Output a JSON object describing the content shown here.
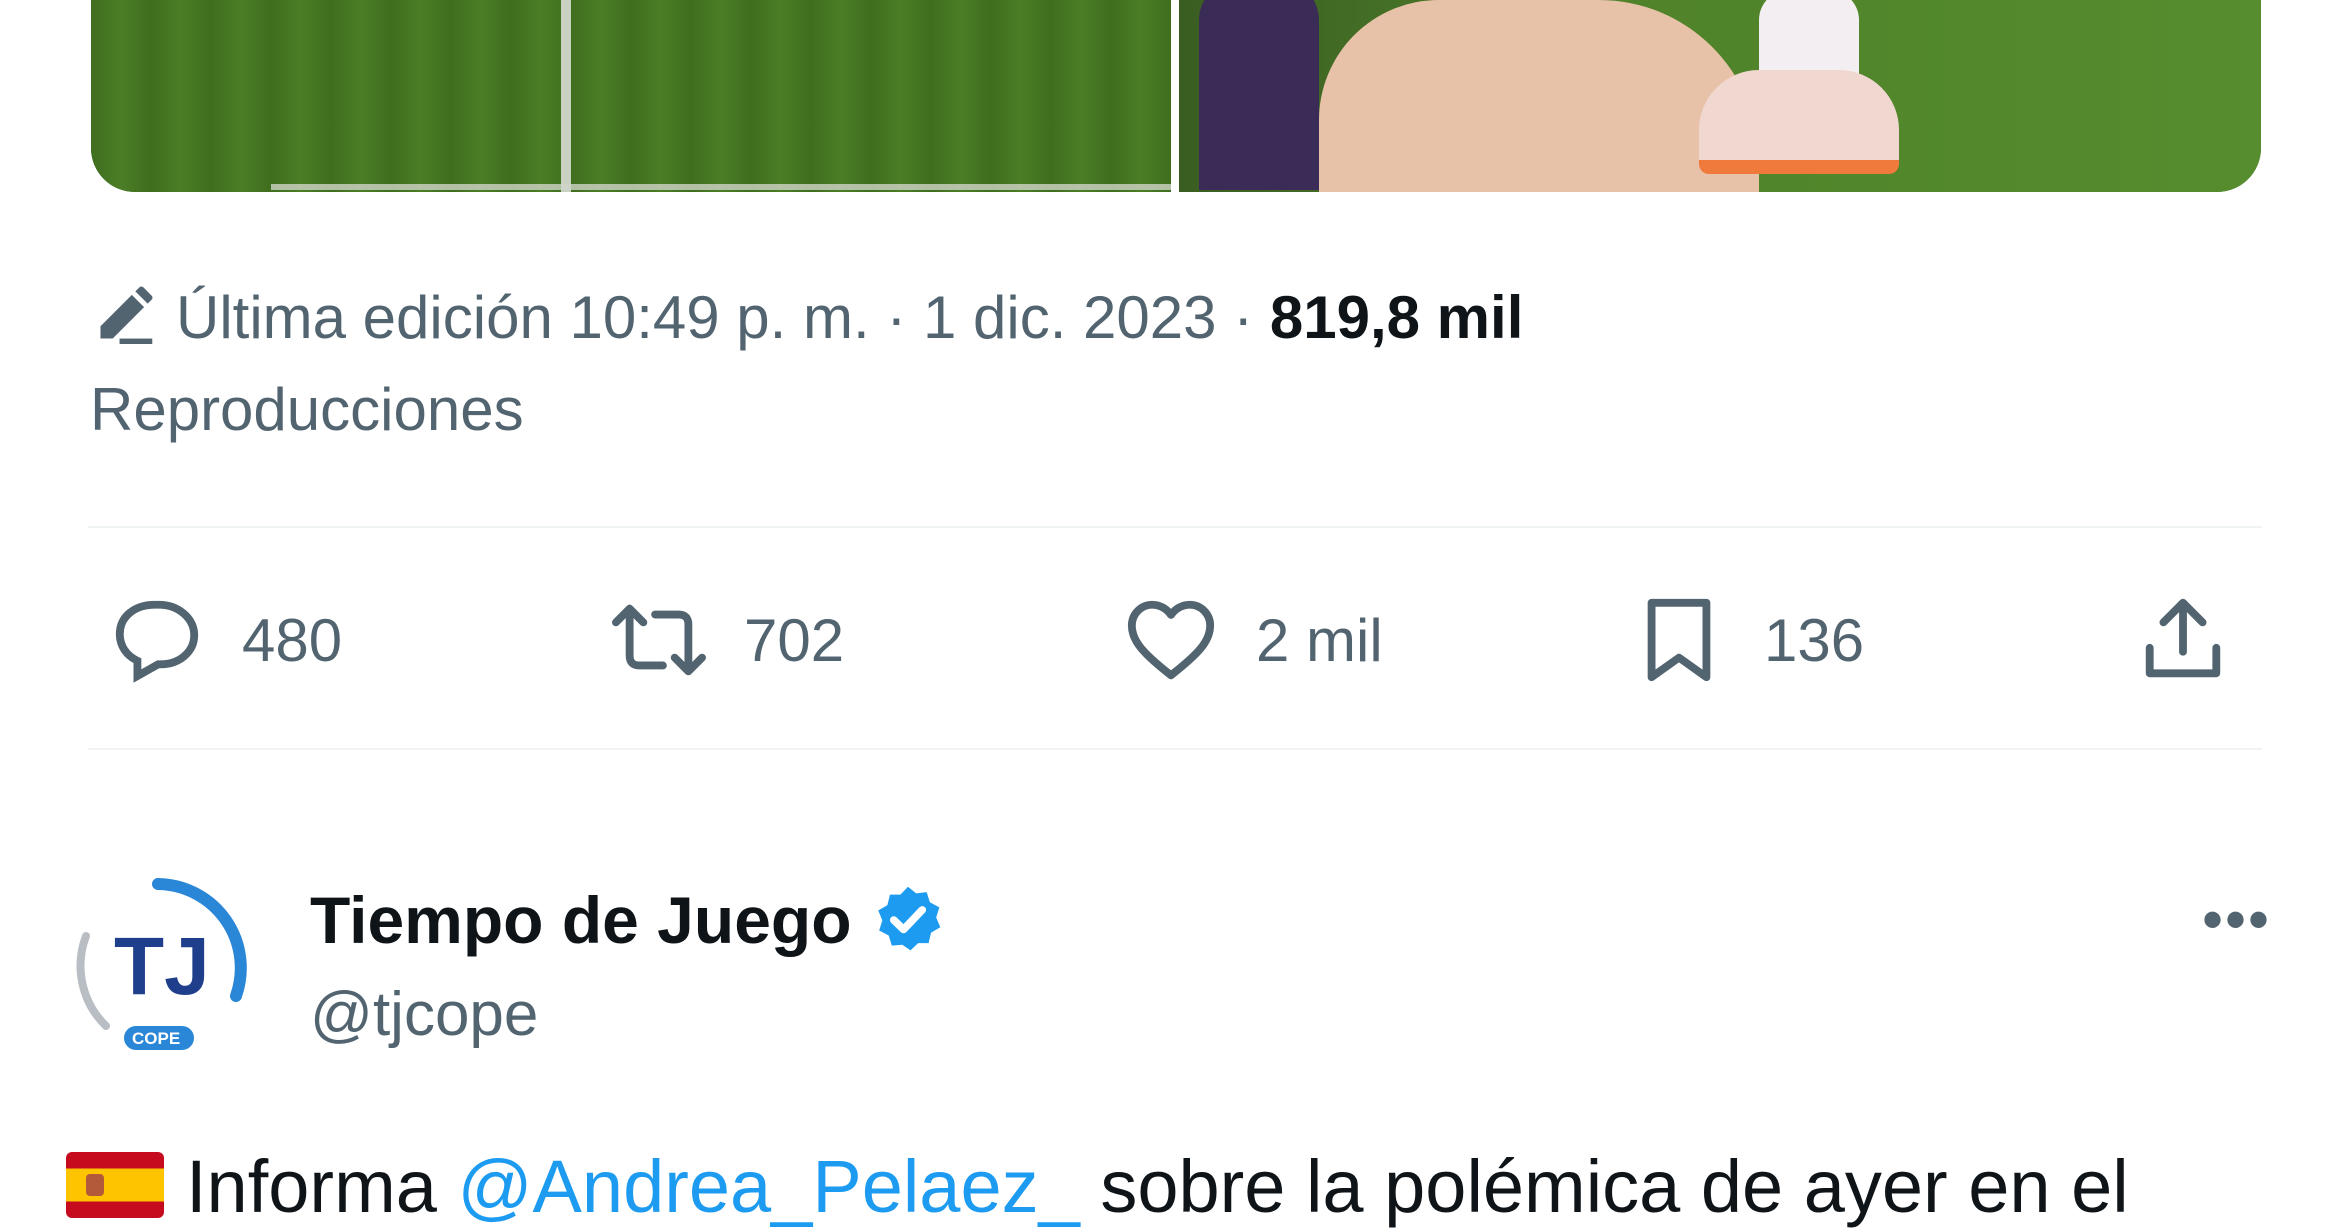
{
  "tweet": {
    "edited_text": "Última edición 10:49 p. m. · 1 dic. 2023 · ",
    "views_count": "819,8 mil",
    "views_label": "Reproducciones",
    "actions": {
      "replies": "480",
      "retweets": "702",
      "likes": "2 mil",
      "bookmarks": "136"
    }
  },
  "next_tweet": {
    "display_name": "Tiempo de Juego",
    "handle": "@tjcope",
    "avatar_initials": "TJ",
    "avatar_sub": "COPE",
    "more_label": "•••",
    "text_prefix": "Informa ",
    "mention": "@Andrea_Pelaez_",
    "text_suffix": " sobre la polémica de ayer en el"
  },
  "colors": {
    "accent": "#1d9bf0",
    "secondary_text": "#536471",
    "primary_text": "#0f1419",
    "divider": "#eff3f4"
  },
  "icons": {
    "edit": "pencil-icon",
    "reply": "reply-icon",
    "retweet": "retweet-icon",
    "like": "heart-icon",
    "bookmark": "bookmark-icon",
    "share": "share-icon",
    "verified": "verified-badge-icon",
    "more": "more-icon",
    "flag": "spain-flag-icon"
  }
}
